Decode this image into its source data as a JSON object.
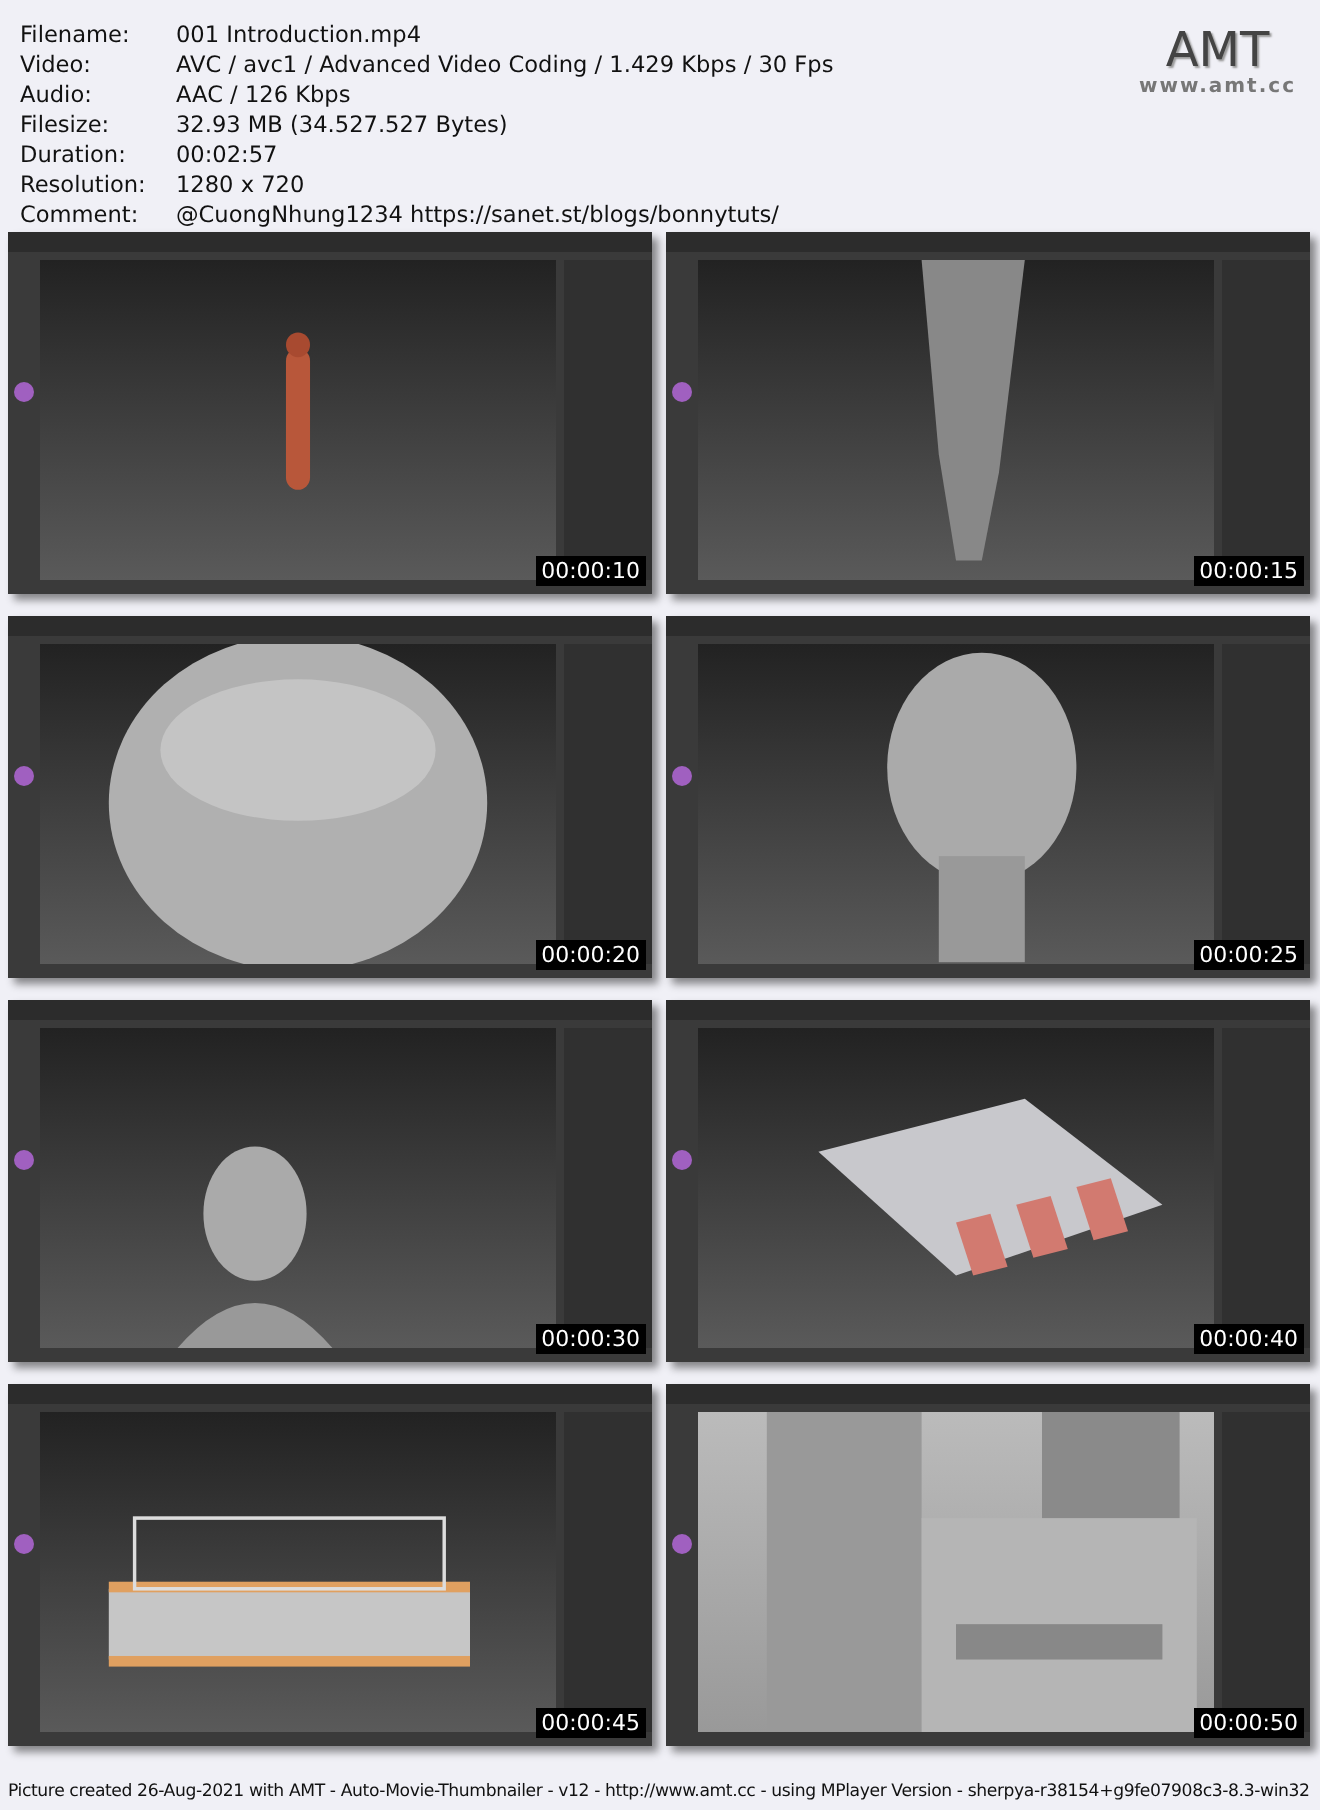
{
  "info": [
    {
      "label": "Filename:",
      "value": "001 Introduction.mp4"
    },
    {
      "label": "Video:",
      "value": "AVC / avc1 / Advanced Video Coding / 1.429 Kbps / 30 Fps"
    },
    {
      "label": "Audio:",
      "value": "AAC / 126 Kbps"
    },
    {
      "label": "Filesize:",
      "value": "32.93 MB (34.527.527 Bytes)"
    },
    {
      "label": "Duration:",
      "value": "00:02:57"
    },
    {
      "label": "Resolution:",
      "value": "1280 x 720"
    },
    {
      "label": "Comment:",
      "value": "@CuongNhung1234 https://sanet.st/blogs/bonnytuts/"
    }
  ],
  "logo": {
    "title": "AMT",
    "url": "www.amt.cc"
  },
  "thumbnails": [
    {
      "kind": "picture",
      "time": "00:00:10"
    },
    {
      "kind": "picture",
      "time": "00:00:15"
    },
    {
      "kind": "picture",
      "time": "00:00:20"
    },
    {
      "kind": "picture",
      "time": "00:00:25"
    },
    {
      "kind": "picture",
      "time": "00:00:30"
    },
    {
      "kind": "picture",
      "time": "00:00:40"
    },
    {
      "kind": "picture",
      "time": "00:00:45"
    },
    {
      "kind": "picture",
      "time": "00:00:50"
    }
  ],
  "footer": "Picture created 26-Aug-2021 with AMT - Auto-Movie-Thumbnailer - v12 - http://www.amt.cc - using MPlayer Version - sherpya-r38154+g9fe07908c3-8.3-win32"
}
